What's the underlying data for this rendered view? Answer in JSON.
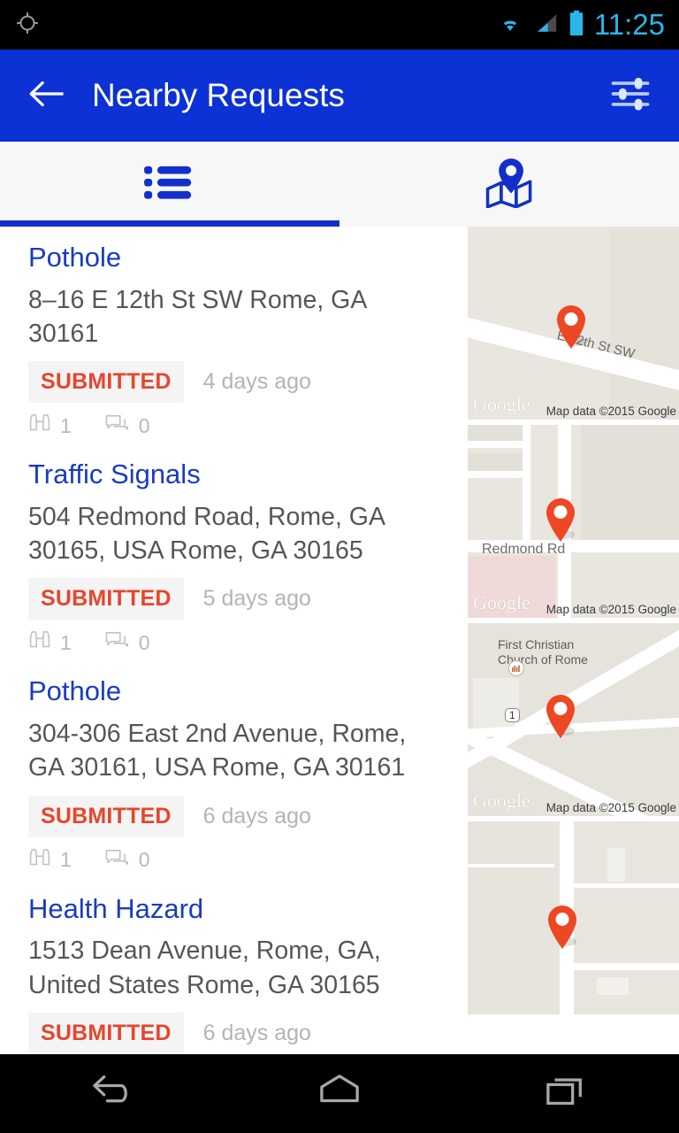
{
  "status_bar": {
    "time": "11:25",
    "icons": [
      "gps-crosshair-icon",
      "wifi-icon",
      "cellular-signal-icon",
      "battery-icon"
    ],
    "accent_color": "#29b6e8"
  },
  "app_bar": {
    "title": "Nearby Requests",
    "back_icon": "arrow-left-icon",
    "filter_icon": "filter-sliders-icon",
    "background_color": "#0c31d4"
  },
  "tabs": [
    {
      "name": "list",
      "icon": "list-icon",
      "active": true
    },
    {
      "name": "map",
      "icon": "map-pin-icon",
      "active": false
    }
  ],
  "theme": {
    "link_blue": "#1a3cc2",
    "status_orange": "#e8452c",
    "badge_bg": "#f4f4f5",
    "muted_gray": "#b4b4b6",
    "body_gray": "#55565a"
  },
  "requests": [
    {
      "title": "Pothole",
      "address": "8–16 E 12th St SW Rome, GA 30161",
      "status": "SUBMITTED",
      "time_ago": "4 days ago",
      "watch_count": "1",
      "comment_count": "0",
      "map": {
        "road_label": "E 12th St SW",
        "poi_label": "",
        "attribution": "Map data ©2015 Google",
        "watermark": "Google"
      }
    },
    {
      "title": "Traffic Signals",
      "address": "504 Redmond Road, Rome, GA 30165, USA Rome, GA 30165",
      "status": "SUBMITTED",
      "time_ago": "5 days ago",
      "watch_count": "1",
      "comment_count": "0",
      "map": {
        "road_label": "Redmond Rd",
        "poi_label": "",
        "attribution": "Map data ©2015 Google",
        "watermark": "Google"
      }
    },
    {
      "title": "Pothole",
      "address": "304-306 East 2nd Avenue, Rome, GA 30161, USA Rome, GA 30161",
      "status": "SUBMITTED",
      "time_ago": "6 days ago",
      "watch_count": "1",
      "comment_count": "0",
      "map": {
        "road_label": "",
        "poi_label": "First Christian Church of Rome",
        "shield_label": "1",
        "attribution": "Map data ©2015 Google",
        "watermark": "Google"
      }
    },
    {
      "title": "Health Hazard",
      "address": "1513 Dean Avenue, Rome, GA, United States Rome, GA 30165",
      "status": "SUBMITTED",
      "time_ago": "6 days ago",
      "watch_count": "",
      "comment_count": "",
      "map": {
        "road_label": "",
        "poi_label": "",
        "attribution": "",
        "watermark": ""
      }
    }
  ],
  "nav_bar": {
    "buttons": [
      {
        "name": "back",
        "icon": "nav-back-icon"
      },
      {
        "name": "home",
        "icon": "nav-home-icon"
      },
      {
        "name": "recents",
        "icon": "nav-recents-icon"
      }
    ]
  }
}
